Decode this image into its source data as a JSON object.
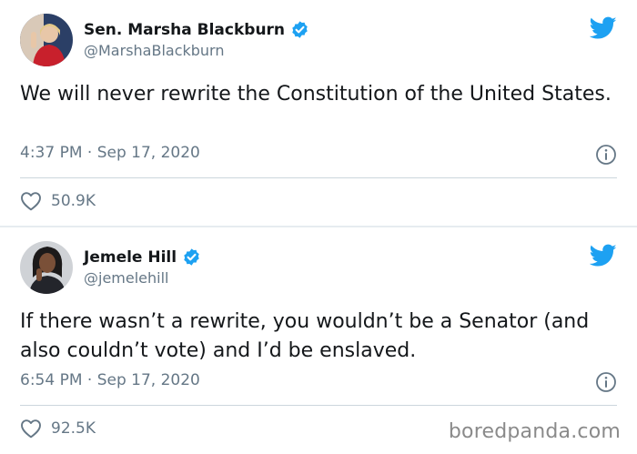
{
  "tweets": [
    {
      "name": "Sen. Marsha Blackburn",
      "handle": "@MarshaBlackburn",
      "text": "We will never rewrite the Constitution of the United States.",
      "timestamp": "4:37 PM · Sep 17, 2020",
      "likes": "50.9K"
    },
    {
      "name": "Jemele Hill",
      "handle": "@jemelehill",
      "text": "If there wasn’t a rewrite, you wouldn’t be a Senator (and also couldn’t vote) and I’d be enslaved.",
      "timestamp": "6:54 PM · Sep 17, 2020",
      "likes": "92.5K"
    }
  ],
  "watermark": "boredpanda.com",
  "colors": {
    "twitter_blue": "#1da1f2",
    "muted_text": "#657786",
    "divider": "#ccd6dd"
  },
  "icons": [
    "twitter-bird-icon",
    "verified-badge-icon",
    "info-icon",
    "heart-icon"
  ]
}
